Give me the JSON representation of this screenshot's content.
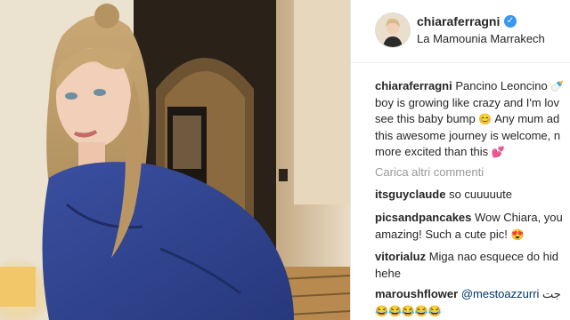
{
  "post": {
    "username": "chiaraferragni",
    "location": "La Mamounia Marrakech",
    "caption_lines": [
      "Pancino Leoncino",
      "boy is growing like crazy and I'm lov",
      "see this baby bump",
      "Any mum ad",
      "this awesome journey is welcome, n",
      "more excited than this"
    ],
    "load_more": "Carica altri commenti"
  },
  "comments": [
    {
      "user": "itsguyclaude",
      "lines": [
        "so cuuuuute"
      ]
    },
    {
      "user": "picsandpancakes",
      "lines": [
        "Wow Chiara, you",
        "amazing! Such a cute pic!"
      ]
    },
    {
      "user": "vitorialuz",
      "lines": [
        "Miga nao esquece do hid",
        "hehe"
      ]
    },
    {
      "user": "maroushflower",
      "lines": [
        "@mestoazzurri",
        "جت"
      ]
    }
  ],
  "icons": {
    "verified": "verified-check-icon",
    "emoji": "emoji-icon"
  },
  "colors": {
    "verified": "#3897f0",
    "muted": "#999999",
    "text": "#262626",
    "mention": "#003569",
    "heart": "#e8467c"
  }
}
